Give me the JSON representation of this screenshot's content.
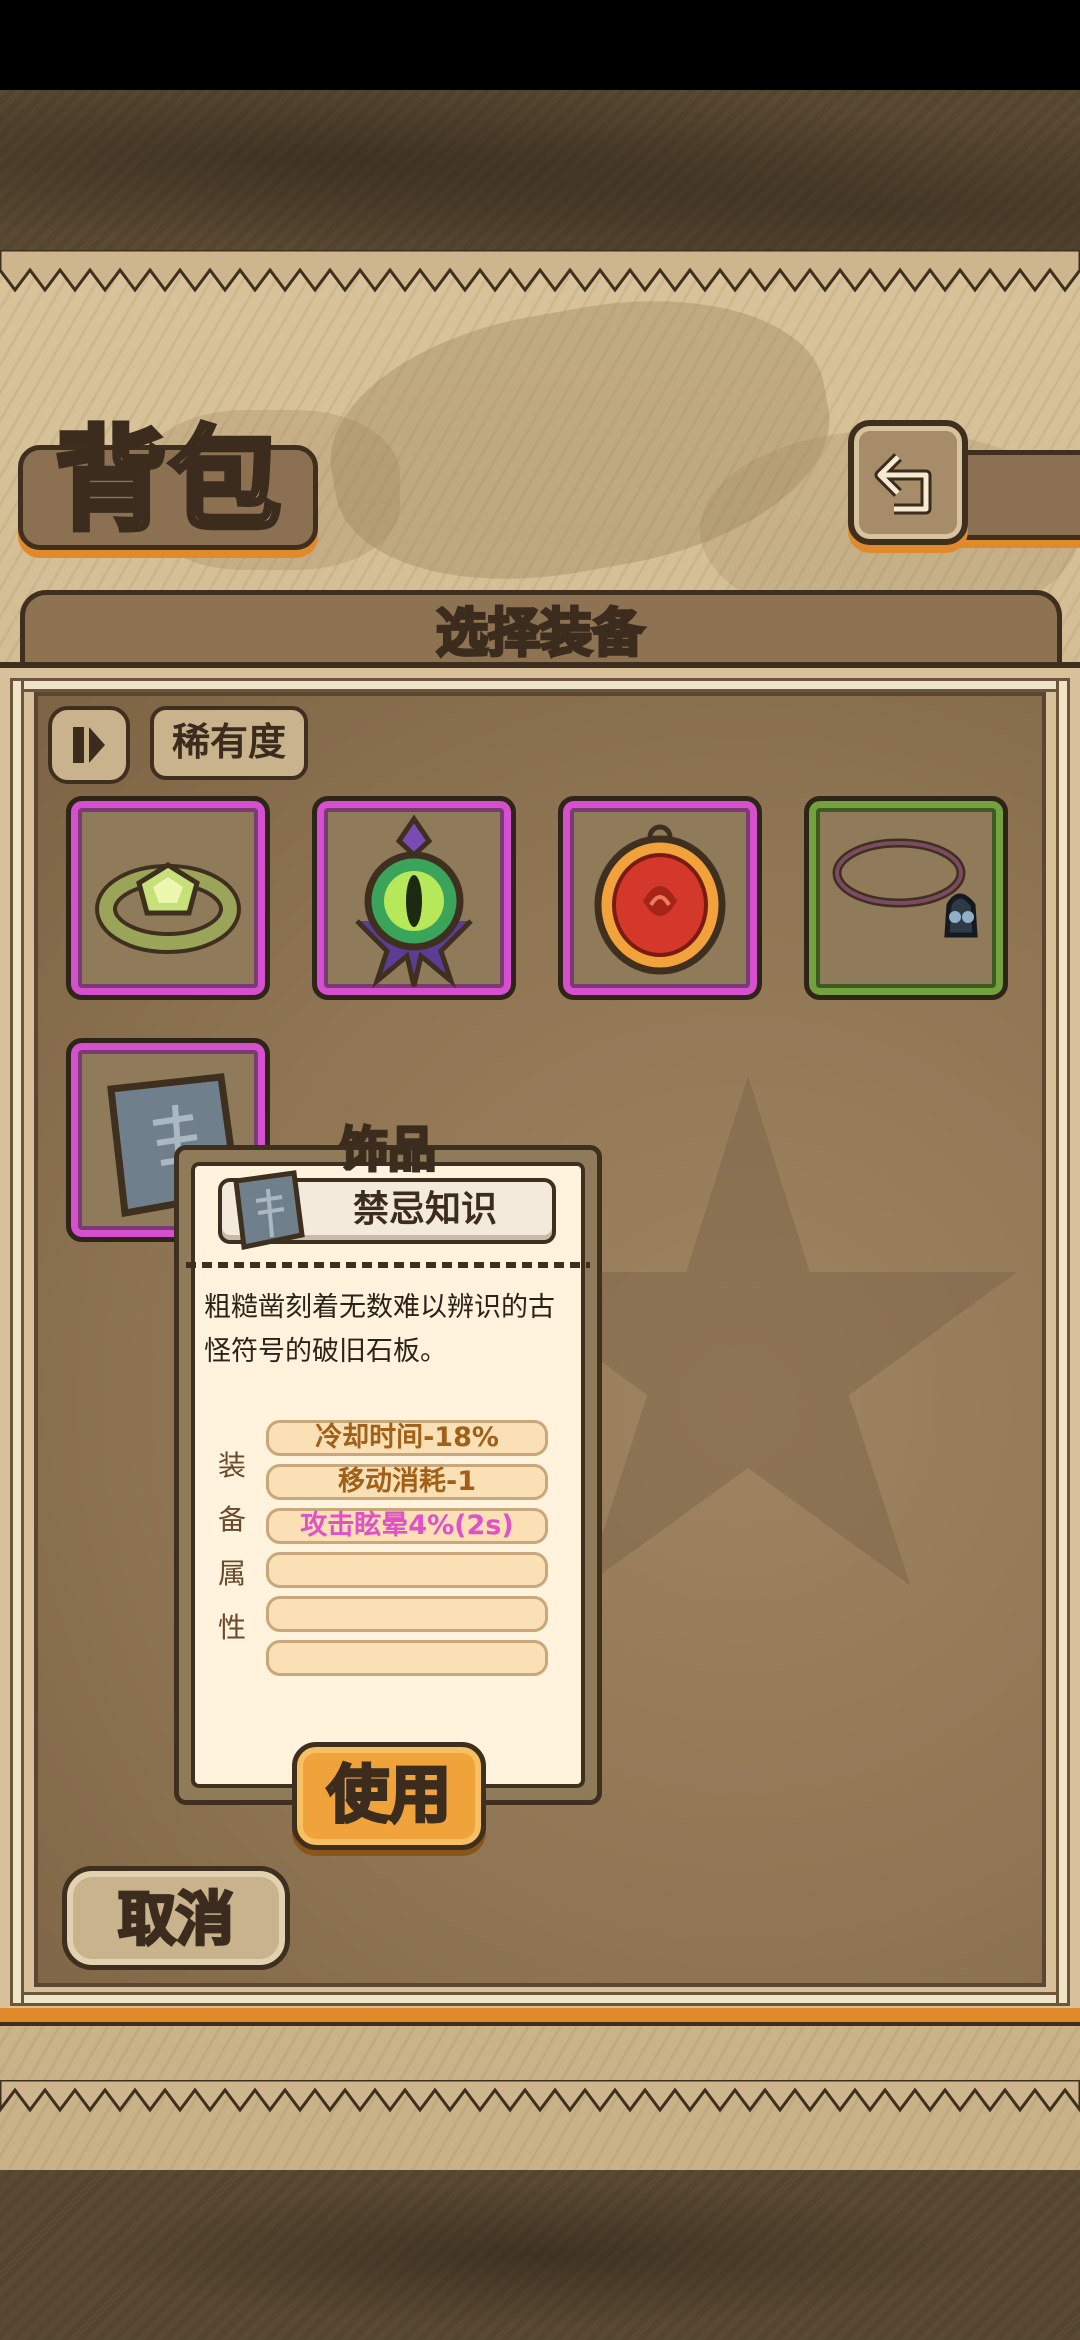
{
  "screen": {
    "title": "背包",
    "panel_title": "选择装备"
  },
  "filters": {
    "rarity_label": "稀有度"
  },
  "inventory": {
    "items": [
      {
        "name": "green-gem-ring",
        "rarity_color": "#d64fcf"
      },
      {
        "name": "eye-amulet",
        "rarity_color": "#d64fcf"
      },
      {
        "name": "red-rose-pendant",
        "rarity_color": "#d64fcf"
      },
      {
        "name": "skull-necklace",
        "rarity_color": "#73a13d"
      },
      {
        "name": "stone-tablet",
        "rarity_color": "#d64fcf"
      }
    ]
  },
  "tooltip": {
    "category": "饰品",
    "item_name": "禁忌知识",
    "description": "粗糙凿刻着无数难以辨识的古怪符号的破旧石板。",
    "attr_label_chars": [
      "装",
      "备",
      "属",
      "性"
    ],
    "attributes": [
      "冷却时间-18%",
      "移动消耗-1",
      "攻击眩晕4%(2s)",
      "",
      "",
      ""
    ],
    "use_label": "使用"
  },
  "actions": {
    "cancel_label": "取消"
  },
  "colors": {
    "accent": "#e08a2b",
    "epic": "#d64fcf",
    "uncommon": "#73a13d",
    "special_attr": "#e052c6"
  }
}
